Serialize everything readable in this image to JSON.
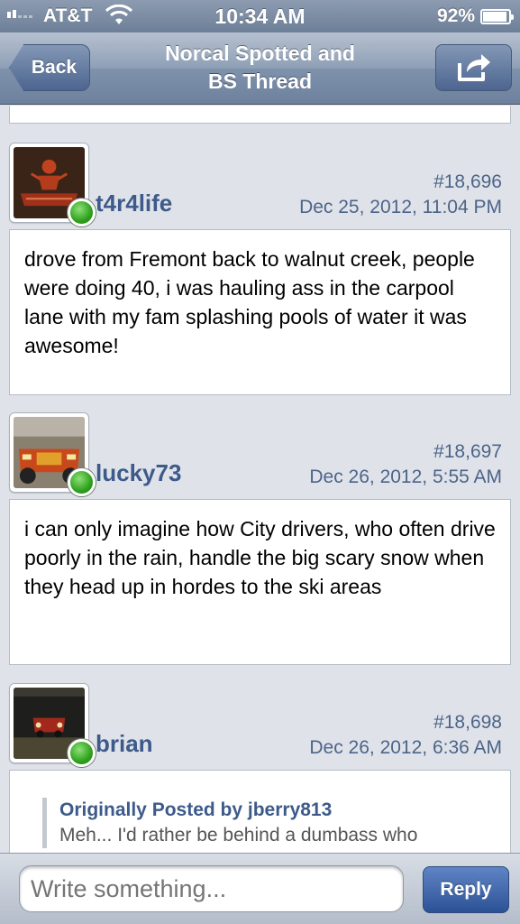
{
  "status_bar": {
    "carrier": "AT&T",
    "time": "10:34 AM",
    "battery_percent": "92%",
    "battery_level": 0.92
  },
  "nav": {
    "back_label": "Back",
    "title_line1": "Norcal Spotted and",
    "title_line2": "BS Thread",
    "share_icon": "share-icon"
  },
  "posts": [
    {
      "username": "t4r4life",
      "number": "#18,696",
      "date": "Dec 25, 2012, 11:04 PM",
      "online": true,
      "message": "drove from Fremont back to walnut creek, people were doing 40, i was hauling ass in the carpool lane with my fam splashing pools of water it was awesome!"
    },
    {
      "username": "lucky73",
      "number": "#18,697",
      "date": "Dec 26, 2012, 5:55 AM",
      "online": true,
      "message": "i can only imagine how City drivers, who often drive poorly in the rain, handle the big scary snow when they head up in hordes to the ski areas"
    },
    {
      "username": "brian",
      "number": "#18,698",
      "date": "Dec 26, 2012, 6:36 AM",
      "online": true,
      "quote_header": "Originally Posted by jberry813",
      "quote_text": "Meh... I'd rather be behind a dumbass who"
    }
  ],
  "reply_bar": {
    "placeholder": "Write something...",
    "reply_label": "Reply"
  },
  "colors": {
    "nav_blue": "#6d819e",
    "link_blue": "#3d5a8a",
    "online_green": "#2ea11c"
  }
}
